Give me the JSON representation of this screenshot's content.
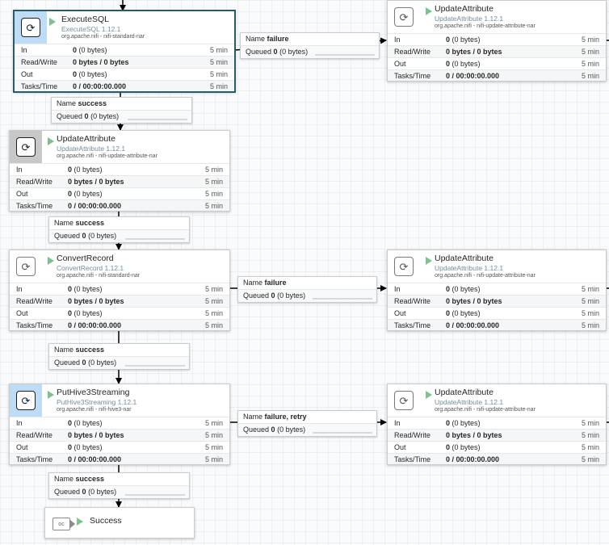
{
  "processors": {
    "execute_sql": {
      "name": "ExecuteSQL",
      "type": "ExecuteSQL 1.12.1",
      "bundle": "org.apache.nifi - nifi-standard-nar",
      "icon": "processor-icon",
      "stats": [
        {
          "label": "In",
          "value": "0",
          "detail": "(0 bytes)",
          "time": "5 min"
        },
        {
          "label": "Read/Write",
          "value": "0 bytes / 0 bytes",
          "detail": "",
          "time": "5 min"
        },
        {
          "label": "Out",
          "value": "0",
          "detail": "(0 bytes)",
          "time": "5 min"
        },
        {
          "label": "Tasks/Time",
          "value": "0 / 00:00:00.000",
          "detail": "",
          "time": "5 min"
        }
      ]
    },
    "update_attr_1": {
      "name": "UpdateAttribute",
      "type": "UpdateAttribute 1.12.1",
      "bundle": "org.apache.nifi - nifi-update-attribute-nar",
      "icon": "processor-icon",
      "stats": [
        {
          "label": "In",
          "value": "0",
          "detail": "(0 bytes)",
          "time": "5 min"
        },
        {
          "label": "Read/Write",
          "value": "0 bytes / 0 bytes",
          "detail": "",
          "time": "5 min"
        },
        {
          "label": "Out",
          "value": "0",
          "detail": "(0 bytes)",
          "time": "5 min"
        },
        {
          "label": "Tasks/Time",
          "value": "0 / 00:00:00.000",
          "detail": "",
          "time": "5 min"
        }
      ]
    },
    "update_attr_top_right": {
      "name": "UpdateAttribute",
      "type": "UpdateAttribute 1.12.1",
      "bundle": "org.apache.nifi - nifi-update-attribute-nar",
      "icon": "processor-icon",
      "stats": [
        {
          "label": "In",
          "value": "0",
          "detail": "(0 bytes)",
          "time": "5 min"
        },
        {
          "label": "Read/Write",
          "value": "0 bytes / 0 bytes",
          "detail": "",
          "time": "5 min"
        },
        {
          "label": "Out",
          "value": "0",
          "detail": "(0 bytes)",
          "time": "5 min"
        },
        {
          "label": "Tasks/Time",
          "value": "0 / 00:00:00.000",
          "detail": "",
          "time": "5 min"
        }
      ]
    },
    "convert_record": {
      "name": "ConvertRecord",
      "type": "ConvertRecord 1.12.1",
      "bundle": "org.apache.nifi - nifi-standard-nar",
      "icon": "processor-icon",
      "stats": [
        {
          "label": "In",
          "value": "0",
          "detail": "(0 bytes)",
          "time": "5 min"
        },
        {
          "label": "Read/Write",
          "value": "0 bytes / 0 bytes",
          "detail": "",
          "time": "5 min"
        },
        {
          "label": "Out",
          "value": "0",
          "detail": "(0 bytes)",
          "time": "5 min"
        },
        {
          "label": "Tasks/Time",
          "value": "0 / 00:00:00.000",
          "detail": "",
          "time": "5 min"
        }
      ]
    },
    "update_attr_mid_right": {
      "name": "UpdateAttribute",
      "type": "UpdateAttribute 1.12.1",
      "bundle": "org.apache.nifi - nifi-update-attribute-nar",
      "icon": "processor-icon",
      "stats": [
        {
          "label": "In",
          "value": "0",
          "detail": "(0 bytes)",
          "time": "5 min"
        },
        {
          "label": "Read/Write",
          "value": "0 bytes / 0 bytes",
          "detail": "",
          "time": "5 min"
        },
        {
          "label": "Out",
          "value": "0",
          "detail": "(0 bytes)",
          "time": "5 min"
        },
        {
          "label": "Tasks/Time",
          "value": "0 / 00:00:00.000",
          "detail": "",
          "time": "5 min"
        }
      ]
    },
    "put_hive": {
      "name": "PutHive3Streaming",
      "type": "PutHive3Streaming 1.12.1",
      "bundle": "org.apache.nifi - nifi-hive3-nar",
      "icon": "processor-icon",
      "stats": [
        {
          "label": "In",
          "value": "0",
          "detail": "(0 bytes)",
          "time": "5 min"
        },
        {
          "label": "Read/Write",
          "value": "0 bytes / 0 bytes",
          "detail": "",
          "time": "5 min"
        },
        {
          "label": "Out",
          "value": "0",
          "detail": "(0 bytes)",
          "time": "5 min"
        },
        {
          "label": "Tasks/Time",
          "value": "0 / 00:00:00.000",
          "detail": "",
          "time": "5 min"
        }
      ]
    },
    "update_attr_bot_right": {
      "name": "UpdateAttribute",
      "type": "UpdateAttribute 1.12.1",
      "bundle": "org.apache.nifi - nifi-update-attribute-nar",
      "icon": "processor-icon",
      "stats": [
        {
          "label": "In",
          "value": "0",
          "detail": "(0 bytes)",
          "time": "5 min"
        },
        {
          "label": "Read/Write",
          "value": "0 bytes / 0 bytes",
          "detail": "",
          "time": "5 min"
        },
        {
          "label": "Out",
          "value": "0",
          "detail": "(0 bytes)",
          "time": "5 min"
        },
        {
          "label": "Tasks/Time",
          "value": "0 / 00:00:00.000",
          "detail": "",
          "time": "5 min"
        }
      ]
    }
  },
  "connections": {
    "c_exec_fail": {
      "name_label": "Name",
      "name": "failure",
      "queued_label": "Queued",
      "queued": "0",
      "queued_detail": "(0 bytes)"
    },
    "c_exec_succ": {
      "name_label": "Name",
      "name": "success",
      "queued_label": "Queued",
      "queued": "0",
      "queued_detail": "(0 bytes)"
    },
    "c_upd_succ": {
      "name_label": "Name",
      "name": "success",
      "queued_label": "Queued",
      "queued": "0",
      "queued_detail": "(0 bytes)"
    },
    "c_conv_fail": {
      "name_label": "Name",
      "name": "failure",
      "queued_label": "Queued",
      "queued": "0",
      "queued_detail": "(0 bytes)"
    },
    "c_conv_succ": {
      "name_label": "Name",
      "name": "success",
      "queued_label": "Queued",
      "queued": "0",
      "queued_detail": "(0 bytes)"
    },
    "c_hive_fail": {
      "name_label": "Name",
      "name": "failure, retry",
      "queued_label": "Queued",
      "queued": "0",
      "queued_detail": "(0 bytes)"
    },
    "c_hive_succ": {
      "name_label": "Name",
      "name": "success",
      "queued_label": "Queued",
      "queued": "0",
      "queued_detail": "(0 bytes)"
    }
  },
  "output_port": {
    "name": "Success",
    "icon": "output-port-icon"
  },
  "colors": {
    "selected_border": "#2a5b66",
    "running_icon": "#7dc28e",
    "type_text": "#728e9b"
  }
}
